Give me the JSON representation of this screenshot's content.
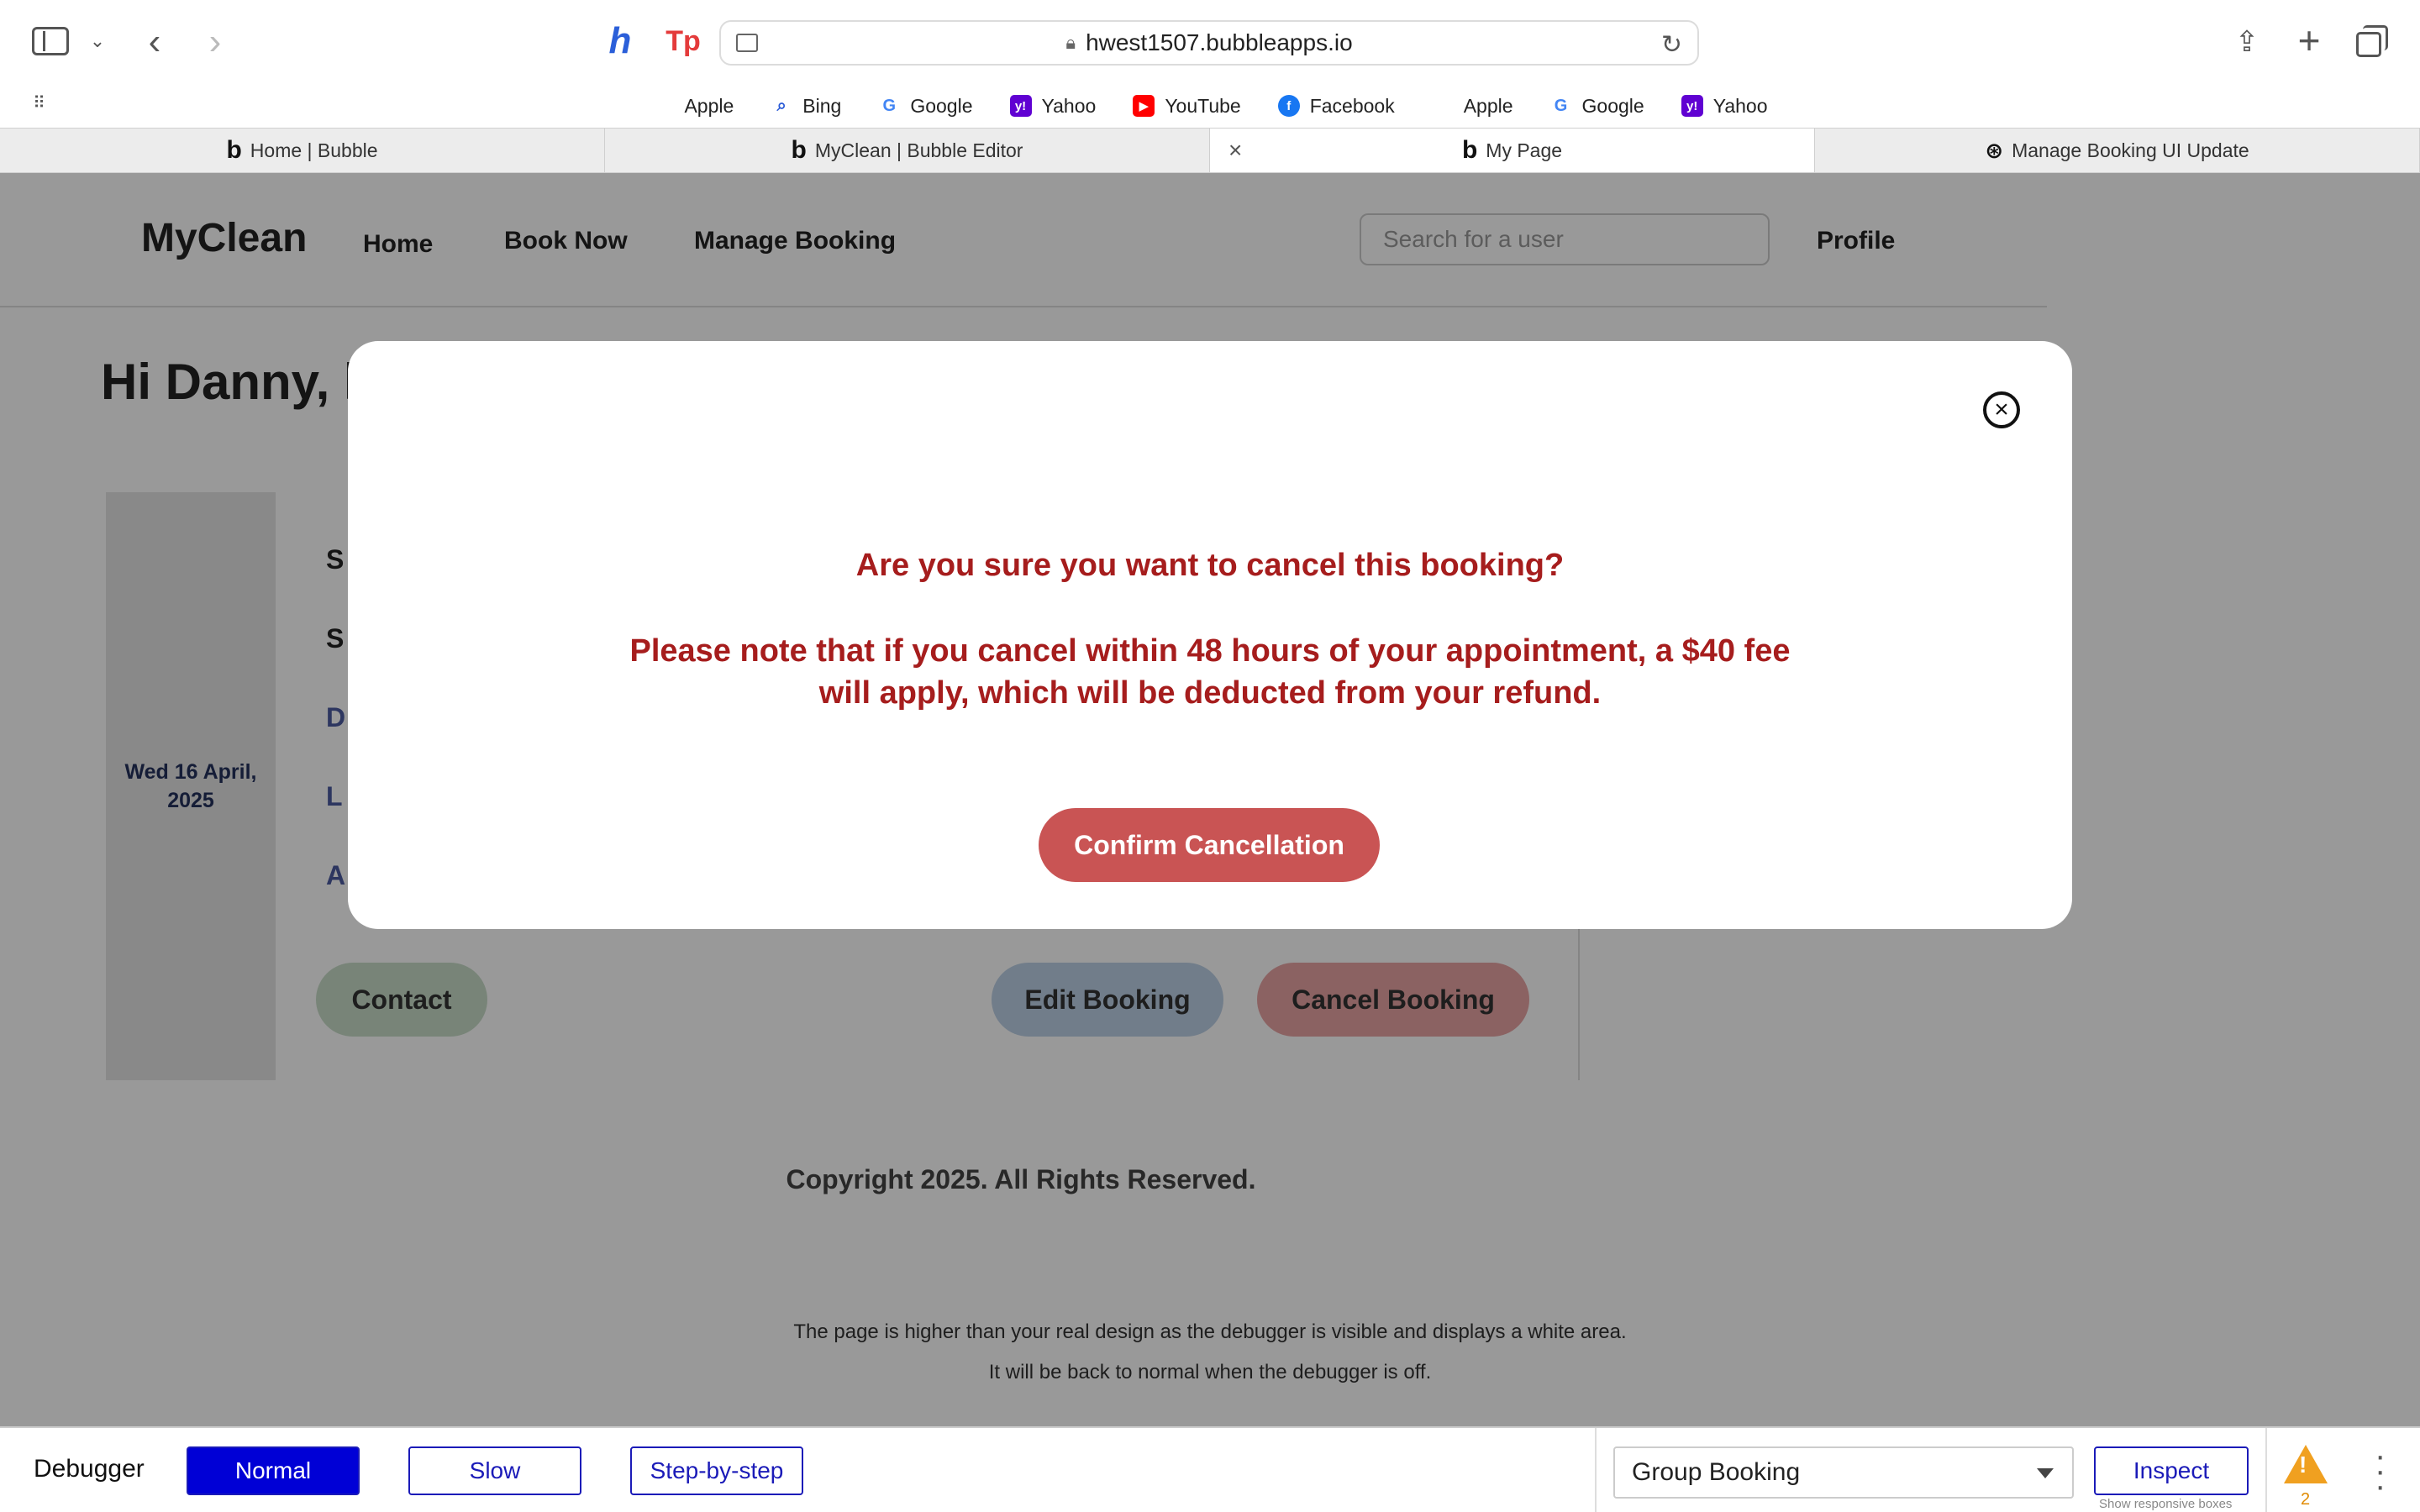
{
  "browser": {
    "url": "hwest1507.bubbleapps.io",
    "bookmarks": [
      {
        "label": "Apple",
        "icon": "apple-icon",
        "glyph": "",
        "color": "#111111"
      },
      {
        "label": "Bing",
        "icon": "bing-search-icon",
        "glyph": "⌕",
        "color": "#2a5bd7"
      },
      {
        "label": "Google",
        "icon": "google-icon",
        "glyph": "G",
        "color": "#4285f4"
      },
      {
        "label": "Yahoo",
        "icon": "yahoo-icon",
        "glyph": "y!",
        "color": "#6001d2"
      },
      {
        "label": "YouTube",
        "icon": "youtube-icon",
        "glyph": "▶",
        "color": "#ff0000"
      },
      {
        "label": "Facebook",
        "icon": "facebook-icon",
        "glyph": "f",
        "color": "#1877f2"
      },
      {
        "label": "Apple",
        "icon": "apple-icon",
        "glyph": "",
        "color": "#111111"
      },
      {
        "label": "Google",
        "icon": "google-icon",
        "glyph": "G",
        "color": "#4285f4"
      },
      {
        "label": "Yahoo",
        "icon": "yahoo-icon",
        "glyph": "y!",
        "color": "#6001d2"
      }
    ],
    "tabs": [
      {
        "label": "Home | Bubble",
        "active": false
      },
      {
        "label": "MyClean | Bubble Editor",
        "active": false
      },
      {
        "label": "My Page",
        "active": true
      },
      {
        "label": "Manage Booking UI Update",
        "active": false
      }
    ]
  },
  "page": {
    "logo": "MyClean",
    "nav": {
      "home": "Home",
      "book_now": "Book Now",
      "manage_booking": "Manage Booking",
      "profile": "Profile"
    },
    "search_placeholder": "Search for a user",
    "greeting": "Hi Danny, h",
    "booking": {
      "date": "Wed 16 April, 2025",
      "frag1": "S",
      "frag2": "S",
      "frag3": "D",
      "frag4": "L",
      "frag5": "A"
    },
    "buttons": {
      "contact": "Contact",
      "edit": "Edit Booking",
      "cancel": "Cancel Booking"
    },
    "copyright": "Copyright 2025. All Rights Reserved.",
    "debug_note_1": "The page is higher than your real design as the debugger is visible and displays a white area.",
    "debug_note_2": "It will be back to normal when the debugger is off."
  },
  "modal": {
    "title": "Are you sure you want to cancel this booking?",
    "body": "Please note that if you cancel within 48 hours of your appointment, a $40 fee will apply, which will be deducted from your refund.",
    "confirm": "Confirm Cancellation"
  },
  "debugger": {
    "label": "Debugger",
    "normal": "Normal",
    "slow": "Slow",
    "step": "Step-by-step",
    "select_value": "Group Booking",
    "inspect": "Inspect",
    "responsive": "Show responsive boxes",
    "warning_count": "2"
  },
  "colors": {
    "accent_red": "#a61d1d",
    "confirm_bg": "#c95454",
    "debugger_blue": "#0000d6"
  }
}
